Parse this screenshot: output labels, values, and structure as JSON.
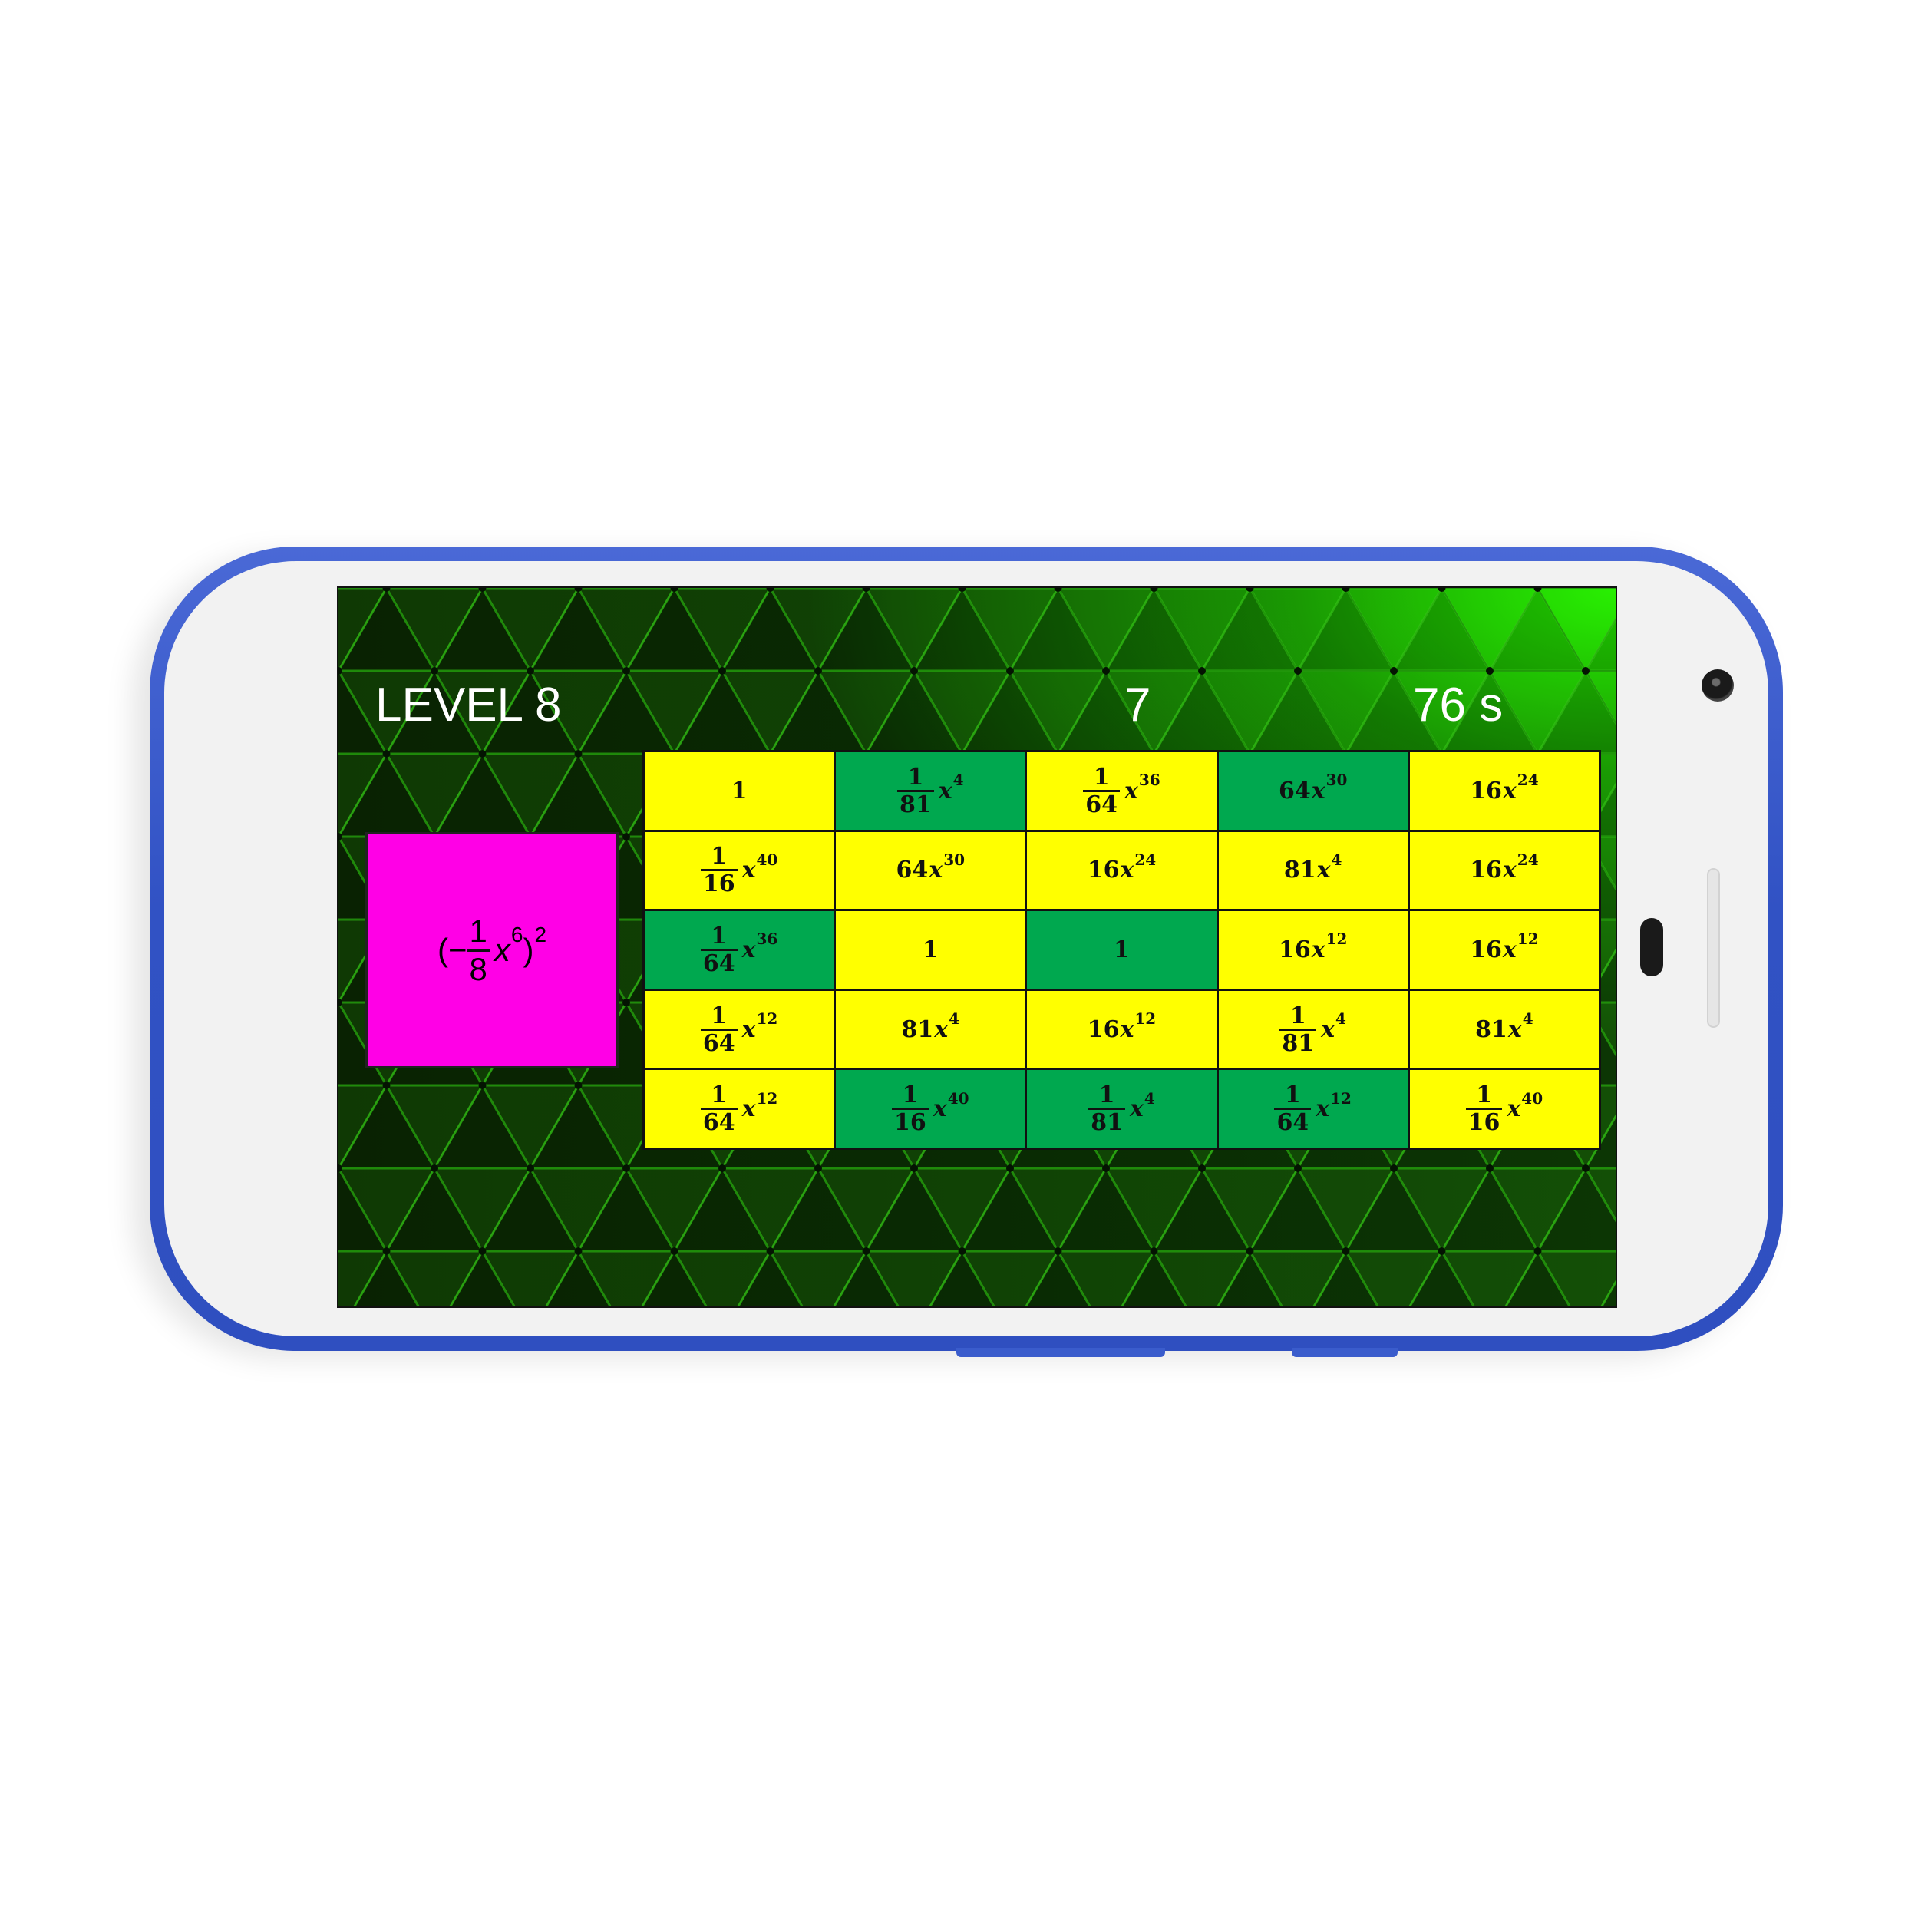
{
  "hud": {
    "level": "LEVEL 8",
    "score": "7",
    "timer": "76 s"
  },
  "target": {
    "open": "(−",
    "num": "1",
    "den": "8",
    "var": "x",
    "exp_inner": "6",
    "close": ")",
    "exp_outer": "2"
  },
  "colors": {
    "tile_yellow": "#ffff00",
    "tile_green": "#00a84f",
    "target_magenta": "#ff00e6",
    "phone_blue": "#3152c4"
  },
  "grid": [
    [
      {
        "num": "1",
        "den": "",
        "coef": "",
        "var": "",
        "exp": "",
        "color": "yellow"
      },
      {
        "num": "1",
        "den": "81",
        "coef": "",
        "var": "x",
        "exp": "4",
        "color": "green"
      },
      {
        "num": "1",
        "den": "64",
        "coef": "",
        "var": "x",
        "exp": "36",
        "color": "yellow"
      },
      {
        "num": "",
        "den": "",
        "coef": "64",
        "var": "x",
        "exp": "30",
        "color": "green"
      },
      {
        "num": "",
        "den": "",
        "coef": "16",
        "var": "x",
        "exp": "24",
        "color": "yellow"
      }
    ],
    [
      {
        "num": "1",
        "den": "16",
        "coef": "",
        "var": "x",
        "exp": "40",
        "color": "yellow"
      },
      {
        "num": "",
        "den": "",
        "coef": "64",
        "var": "x",
        "exp": "30",
        "color": "yellow"
      },
      {
        "num": "",
        "den": "",
        "coef": "16",
        "var": "x",
        "exp": "24",
        "color": "yellow"
      },
      {
        "num": "",
        "den": "",
        "coef": "81",
        "var": "x",
        "exp": "4",
        "color": "yellow"
      },
      {
        "num": "",
        "den": "",
        "coef": "16",
        "var": "x",
        "exp": "24",
        "color": "yellow"
      }
    ],
    [
      {
        "num": "1",
        "den": "64",
        "coef": "",
        "var": "x",
        "exp": "36",
        "color": "green"
      },
      {
        "num": "1",
        "den": "",
        "coef": "",
        "var": "",
        "exp": "",
        "color": "yellow"
      },
      {
        "num": "1",
        "den": "",
        "coef": "",
        "var": "",
        "exp": "",
        "color": "green"
      },
      {
        "num": "",
        "den": "",
        "coef": "16",
        "var": "x",
        "exp": "12",
        "color": "yellow"
      },
      {
        "num": "",
        "den": "",
        "coef": "16",
        "var": "x",
        "exp": "12",
        "color": "yellow"
      }
    ],
    [
      {
        "num": "1",
        "den": "64",
        "coef": "",
        "var": "x",
        "exp": "12",
        "color": "yellow"
      },
      {
        "num": "",
        "den": "",
        "coef": "81",
        "var": "x",
        "exp": "4",
        "color": "yellow"
      },
      {
        "num": "",
        "den": "",
        "coef": "16",
        "var": "x",
        "exp": "12",
        "color": "yellow"
      },
      {
        "num": "1",
        "den": "81",
        "coef": "",
        "var": "x",
        "exp": "4",
        "color": "yellow"
      },
      {
        "num": "",
        "den": "",
        "coef": "81",
        "var": "x",
        "exp": "4",
        "color": "yellow"
      }
    ],
    [
      {
        "num": "1",
        "den": "64",
        "coef": "",
        "var": "x",
        "exp": "12",
        "color": "yellow"
      },
      {
        "num": "1",
        "den": "16",
        "coef": "",
        "var": "x",
        "exp": "40",
        "color": "green"
      },
      {
        "num": "1",
        "den": "81",
        "coef": "",
        "var": "x",
        "exp": "4",
        "color": "green"
      },
      {
        "num": "1",
        "den": "64",
        "coef": "",
        "var": "x",
        "exp": "12",
        "color": "green"
      },
      {
        "num": "1",
        "den": "16",
        "coef": "",
        "var": "x",
        "exp": "40",
        "color": "yellow"
      }
    ]
  ]
}
